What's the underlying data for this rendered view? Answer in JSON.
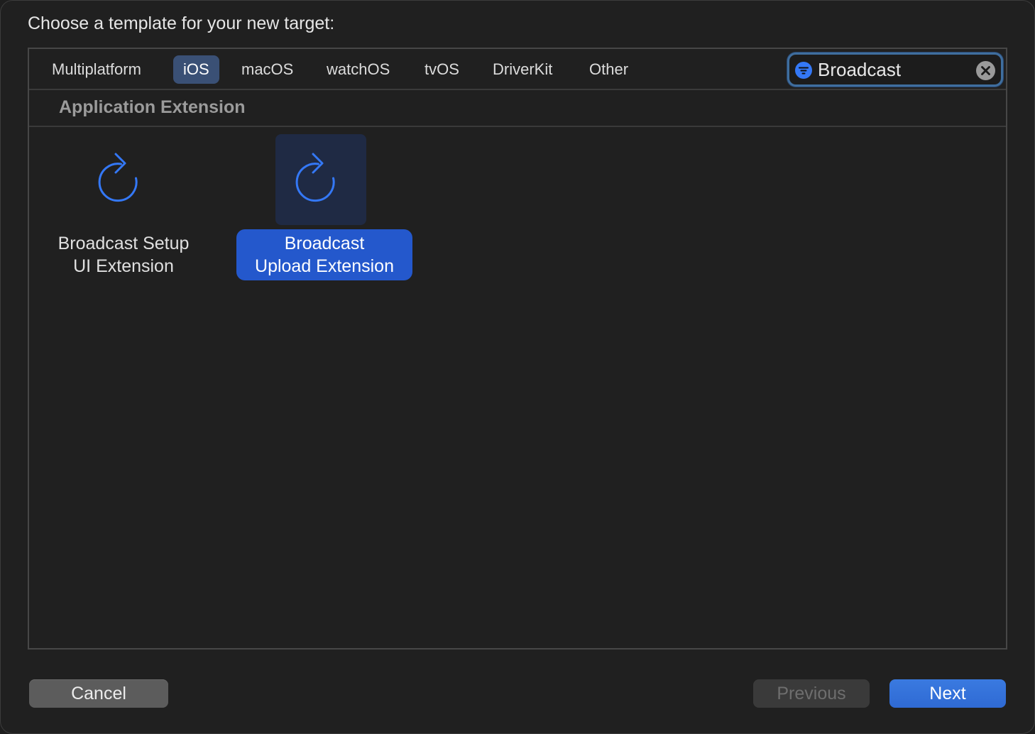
{
  "dialog": {
    "prompt": "Choose a template for your new target:"
  },
  "tabs": [
    {
      "label": "Multiplatform",
      "active": false
    },
    {
      "label": "iOS",
      "active": true
    },
    {
      "label": "macOS",
      "active": false
    },
    {
      "label": "watchOS",
      "active": false
    },
    {
      "label": "tvOS",
      "active": false
    },
    {
      "label": "DriverKit",
      "active": false
    },
    {
      "label": "Other",
      "active": false
    }
  ],
  "search": {
    "value": "Broadcast",
    "filter_icon": "filter-icon",
    "clear_icon": "clear-icon"
  },
  "section": {
    "title": "Application Extension"
  },
  "templates": [
    {
      "label_line1": "Broadcast Setup",
      "label_line2": "UI Extension",
      "icon": "clockwise-arrow-icon",
      "selected": false
    },
    {
      "label_line1": "Broadcast",
      "label_line2": "Upload Extension",
      "icon": "clockwise-arrow-icon",
      "selected": true
    }
  ],
  "buttons": {
    "cancel": "Cancel",
    "previous": "Previous",
    "next": "Next"
  },
  "colors": {
    "accent": "#2458cc",
    "icon_blue": "#3478f6",
    "active_tab": "#3a5075"
  }
}
